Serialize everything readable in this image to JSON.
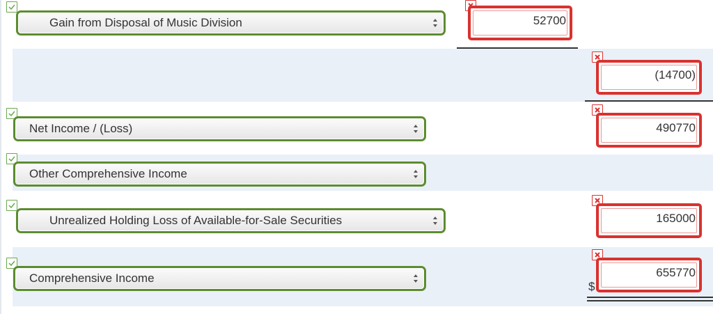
{
  "rows": [
    {
      "label": "Gain from Disposal of Music Division",
      "value": "52700"
    },
    {
      "label": "",
      "value": "(14700)"
    },
    {
      "label": "Net Income / (Loss)",
      "value": "490770"
    },
    {
      "label": "Other Comprehensive Income",
      "value": ""
    },
    {
      "label": "Unrealized Holding Loss of Available-for-Sale Securities",
      "value": "165000"
    },
    {
      "label": "Comprehensive Income",
      "value": "655770",
      "prefix": "$"
    }
  ],
  "colors": {
    "correct_border": "#5c8c2f",
    "incorrect_border": "#d9322f",
    "band": "#e9f0f8"
  }
}
